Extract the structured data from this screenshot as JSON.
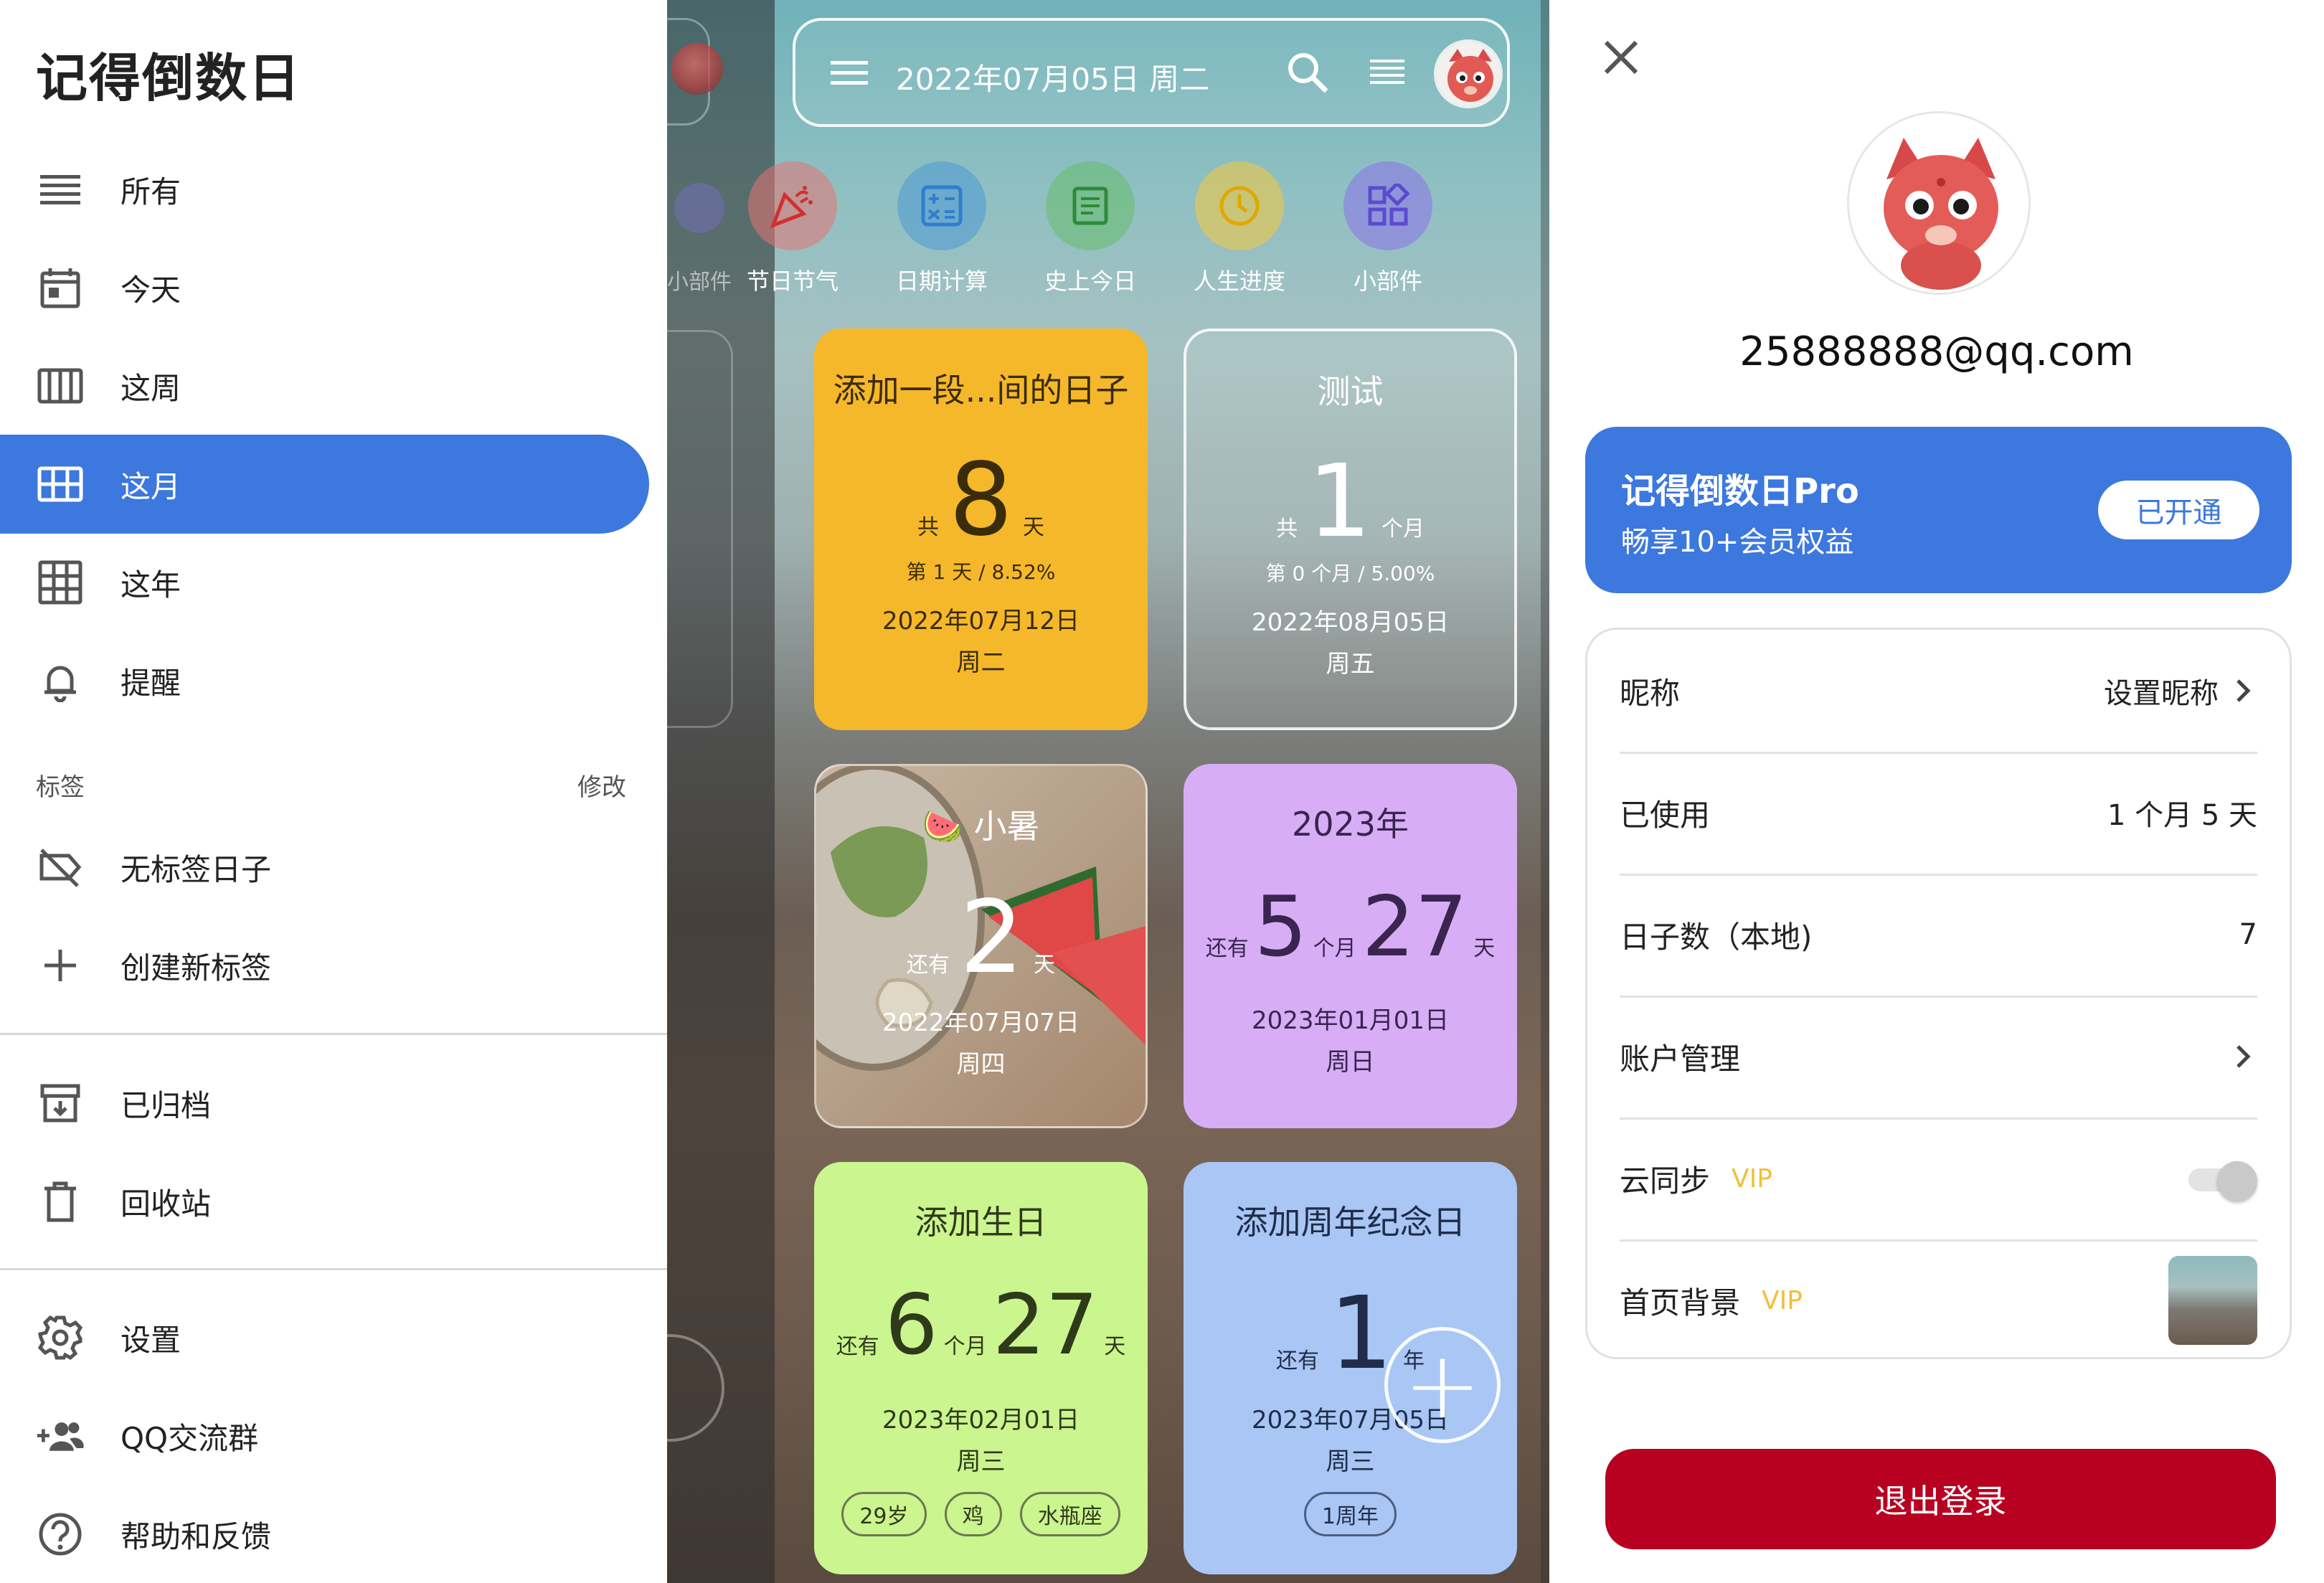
{
  "drawer": {
    "title": "记得倒数日",
    "items": [
      {
        "label": "所有"
      },
      {
        "label": "今天"
      },
      {
        "label": "这周"
      },
      {
        "label": "这月"
      },
      {
        "label": "这年"
      },
      {
        "label": "提醒"
      }
    ],
    "tags_header": "标签",
    "tags_edit": "修改",
    "tag_items": [
      {
        "label": "无标签日子"
      },
      {
        "label": "创建新标签"
      }
    ],
    "archive_items": [
      {
        "label": "已归档"
      },
      {
        "label": "回收站"
      }
    ],
    "bottom_items": [
      {
        "label": "设置"
      },
      {
        "label": "QQ交流群"
      },
      {
        "label": "帮助和反馈"
      }
    ],
    "behind_label": "小部件"
  },
  "home": {
    "date": "2022年07月05日 周二",
    "quick_actions": [
      {
        "label": "节日节气",
        "icon": "party-popper-icon",
        "color": "#d9534f"
      },
      {
        "label": "日期计算",
        "icon": "calculator-icon",
        "color": "#4a90c9"
      },
      {
        "label": "史上今日",
        "icon": "document-icon",
        "color": "#5aa85a"
      },
      {
        "label": "人生进度",
        "icon": "clock-icon",
        "color": "#e0b52b"
      },
      {
        "label": "小部件",
        "icon": "widgets-icon",
        "color": "#7a6cd8"
      }
    ],
    "cards": [
      {
        "title": "添加一段...间的日子",
        "prefix": "共",
        "number": "8",
        "unit": "天",
        "progress": "第 1 天 / 8.52%",
        "date": "2022年07月12日",
        "weekday": "周二",
        "color": "#f6b82b"
      },
      {
        "title": "测试",
        "prefix": "共",
        "number": "1",
        "unit": "个月",
        "progress": "第 0 个月 / 5.00%",
        "date": "2022年08月05日",
        "weekday": "周五",
        "color": "transparent"
      },
      {
        "title": "小暑",
        "emoji": "🍉",
        "prefix": "还有",
        "number": "2",
        "unit": "天",
        "date": "2022年07月07日",
        "weekday": "周四"
      },
      {
        "title": "2023年",
        "prefix": "还有",
        "number": "5",
        "mid_unit": "个月",
        "number2": "27",
        "unit": "天",
        "date": "2023年01月01日",
        "weekday": "周日",
        "color": "#d7aef6"
      },
      {
        "title": "添加生日",
        "prefix": "还有",
        "number": "6",
        "mid_unit": "个月",
        "number2": "27",
        "unit": "天",
        "date": "2023年02月01日",
        "weekday": "周三",
        "chips": [
          "29岁",
          "鸡",
          "水瓶座"
        ],
        "color": "#cbf58f"
      },
      {
        "title": "添加周年纪念日",
        "prefix": "还有",
        "number": "1",
        "unit": "年",
        "date": "2023年07月05日",
        "weekday": "周三",
        "chips": [
          "1周年"
        ],
        "color": "#a9c6f5"
      }
    ],
    "fab": "+"
  },
  "profile": {
    "email": "25888888@qq.com",
    "pro_title": "记得倒数日Pro",
    "pro_sub": "畅享10+会员权益",
    "pro_button": "已开通",
    "rows": [
      {
        "label": "昵称",
        "value": "设置昵称"
      },
      {
        "label": "已使用",
        "value": "1 个月 5 天"
      },
      {
        "label": "日子数（本地)",
        "value": "7"
      },
      {
        "label": "账户管理",
        "value": ""
      },
      {
        "label": "云同步",
        "vip": "VIP"
      },
      {
        "label": "首页背景",
        "vip": "VIP"
      }
    ],
    "logout": "退出登录"
  }
}
